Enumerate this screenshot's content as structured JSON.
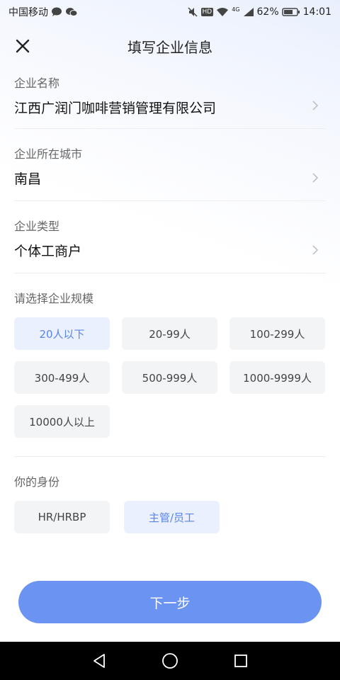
{
  "status_bar": {
    "carrier": "中国移动",
    "hd": "HD",
    "network": "4G",
    "battery": "62%",
    "time": "14:01"
  },
  "header": {
    "title": "填写企业信息"
  },
  "fields": [
    {
      "label": "企业名称",
      "value": "江西广润门咖啡营销管理有限公司"
    },
    {
      "label": "企业所在城市",
      "value": "南昌"
    },
    {
      "label": "企业类型",
      "value": "个体工商户"
    }
  ],
  "scale": {
    "title": "请选择企业规模",
    "options": [
      "20人以下",
      "20-99人",
      "100-299人",
      "300-499人",
      "500-999人",
      "1000-9999人",
      "10000人以上"
    ],
    "selected": "20人以下"
  },
  "identity": {
    "title": "你的身份",
    "options": [
      "HR/HRBP",
      "主管/员工"
    ],
    "selected": "主管/员工"
  },
  "next_button": "下一步",
  "colors": {
    "accent": "#6b93f2",
    "chip_selected_text": "#5a84e6",
    "chip_bg": "#f3f4f6"
  }
}
